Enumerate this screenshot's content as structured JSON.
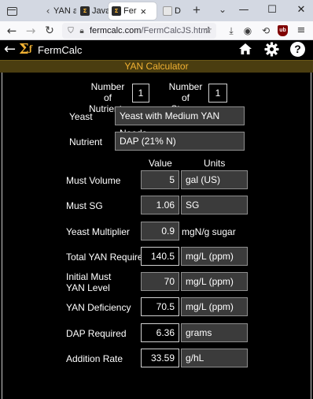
{
  "browser": {
    "tabs": [
      {
        "label": "YAN a",
        "favicon": "back-icon",
        "active": false
      },
      {
        "label": "JavaSc",
        "favicon": "fermcalc-icon",
        "active": false
      },
      {
        "label": "Fer",
        "favicon": "fermcalc-icon",
        "active": true
      },
      {
        "label": "D",
        "favicon": "document-icon",
        "active": false
      }
    ],
    "new_tab": "+",
    "tab_dropdown": "⌄",
    "window_controls": {
      "minimize": "—",
      "maximize": "☐",
      "close": "✕"
    },
    "url_domain": "fermcalc.com",
    "url_path": "/FermCalcJS.html"
  },
  "app": {
    "name": "FermCalc",
    "logo_text": "Σ",
    "logo_sub": "ƒ"
  },
  "calculator": {
    "title": "YAN Calculator",
    "nutrients_label": "Number of Nutrients",
    "nutrients_value": "1",
    "stages_label": "Number of Stages",
    "stages_value": "1",
    "yeast_label": "Yeast",
    "yeast_value": "Yeast with Medium YAN Needs",
    "nutrient_label": "Nutrient",
    "nutrient_value": "DAP  (21% N)",
    "col_value": "Value",
    "col_units": "Units",
    "rows": [
      {
        "label": "Must Volume",
        "value": "5",
        "unit": "gal (US)"
      },
      {
        "label": "Must SG",
        "value": "1.06",
        "unit": "SG"
      },
      {
        "label": "Yeast Multiplier",
        "value": "0.9",
        "unit": "mgN/g sugar"
      },
      {
        "label": "Total YAN Required",
        "value": "140.5",
        "unit": "mg/L (ppm)"
      },
      {
        "label": "Initial Must YAN Level",
        "value": "70",
        "unit": "mg/L (ppm)"
      },
      {
        "label": "YAN Deficiency",
        "value": "70.5",
        "unit": "mg/L (ppm)"
      },
      {
        "label": "DAP Required",
        "value": "6.36",
        "unit": "grams"
      },
      {
        "label": "Addition Rate",
        "value": "33.59",
        "unit": "g/hL"
      }
    ]
  }
}
